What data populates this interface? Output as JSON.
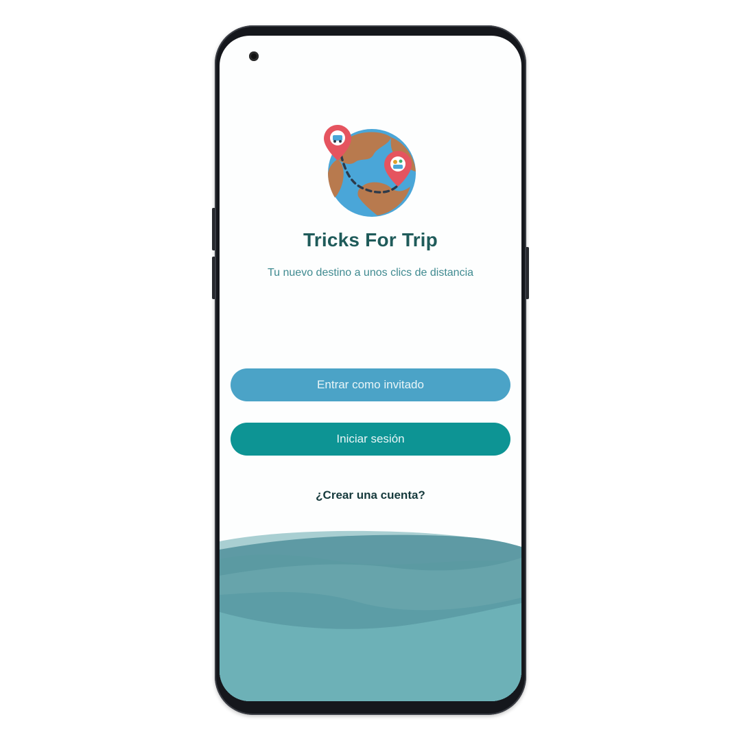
{
  "app": {
    "title": "Tricks For Trip",
    "tagline": "Tu nuevo destino a unos clics de distancia"
  },
  "actions": {
    "guest_label": "Entrar como invitado",
    "login_label": "Iniciar sesión",
    "create_account_label": "¿Crear una cuenta?"
  },
  "icons": {
    "logo": "globe-with-map-pins-icon",
    "camera": "front-camera"
  },
  "colors": {
    "title": "#1f5b5a",
    "tagline": "#3f8a90",
    "guest_button": "#4ba3c7",
    "login_button": "#0d9494",
    "link": "#163a3c",
    "wave_light": "#6cb0b6",
    "wave_dark": "#4f8f99"
  }
}
